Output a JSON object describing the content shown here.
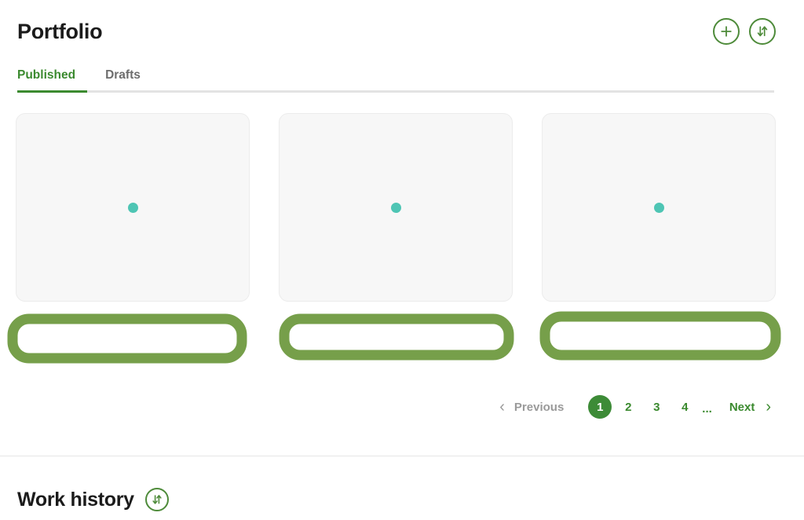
{
  "header": {
    "title": "Portfolio",
    "actions": [
      {
        "name": "add-button",
        "icon": "plus-icon",
        "label": ""
      },
      {
        "name": "sort-button",
        "icon": "sort-arrows-icon",
        "label": ""
      }
    ]
  },
  "tabs": [
    {
      "label": "Published",
      "active": true
    },
    {
      "label": "Drafts",
      "active": false
    }
  ],
  "cards": [
    {
      "name": "portfolio-card-1",
      "placeholder_dot": "teal-dot"
    },
    {
      "name": "portfolio-card-2",
      "placeholder_dot": "teal-dot"
    },
    {
      "name": "portfolio-card-3",
      "placeholder_dot": "teal-dot"
    }
  ],
  "pagination": {
    "previous_label": "Previous",
    "next_label": "Next",
    "prev_arrow": "‹",
    "next_arrow": "›",
    "pages": [
      "1",
      "2",
      "3",
      "4"
    ],
    "ellipsis": "...",
    "current_page": "1"
  },
  "work_history": {
    "title": "Work history",
    "sort_icon": "sort-arrows-icon"
  },
  "colors": {
    "accent_green": "#3b8a2f",
    "outline_green": "#4e8b3a",
    "highlight_green": "#769f4a",
    "active_page_green": "#3d8b37",
    "teal_dot": "#4ec5b4",
    "muted_text": "#6d6d6d",
    "disabled_text": "#9a9a9a",
    "card_bg": "#f7f7f7",
    "divider": "#e6e6e6"
  }
}
